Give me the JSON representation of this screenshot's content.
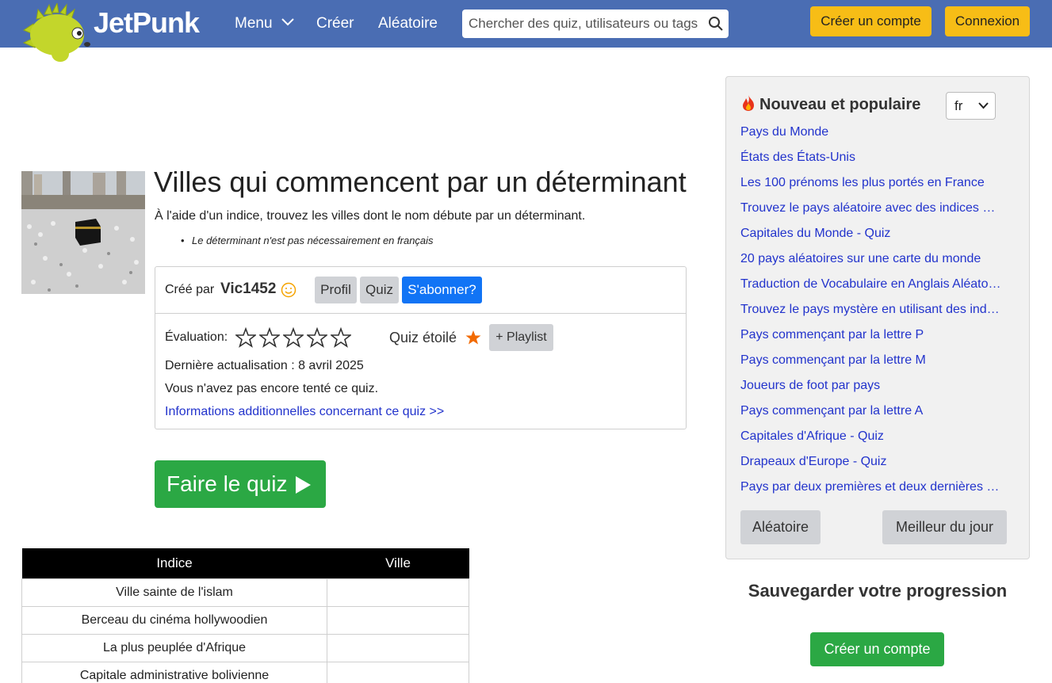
{
  "header": {
    "logo_text": "JetPunk",
    "nav": {
      "menu": "Menu",
      "create": "Créer",
      "random": "Aléatoire"
    },
    "search_placeholder": "Chercher des quiz, utilisateurs ou tags",
    "register": "Créer un compte",
    "login": "Connexion",
    "brand_color": "#4a6db3",
    "accent_color": "#f7bd16"
  },
  "quiz": {
    "title": "Villes qui commencent par un déterminant",
    "description": "À l'aide d'un indice, trouvez les villes dont le nom débute par un déterminant.",
    "note": "Le déterminant n'est pas nécessairement en français",
    "created_by_label": "Créé par",
    "author": "Vic1452",
    "profile_button": "Profil",
    "quiz_button": "Quiz",
    "subscribe_button": "S'abonner?",
    "rating_label": "Évaluation:",
    "rating_stars_filled": 0,
    "rating_stars_total": 5,
    "starred_label": "Quiz étoilé",
    "playlist_button": "+ Playlist",
    "updated": "Dernière actualisation : 8 avril 2025",
    "not_tried": "Vous n'avez pas encore tenté ce quiz.",
    "more_info": "Informations additionnelles concernant ce quiz >>",
    "take_quiz": "Faire le quiz"
  },
  "table": {
    "headers": [
      "Indice",
      "Ville"
    ],
    "rows": [
      {
        "clue": "Ville sainte de l'islam",
        "answer": ""
      },
      {
        "clue": "Berceau du cinéma hollywoodien",
        "answer": ""
      },
      {
        "clue": "La plus peuplée d'Afrique",
        "answer": ""
      },
      {
        "clue": "Capitale administrative bolivienne",
        "answer": ""
      }
    ]
  },
  "sidebar": {
    "title": "Nouveau et populaire",
    "language": "fr",
    "items": [
      "Pays du Monde",
      "États des États-Unis",
      "Les 100 prénoms les plus portés en France",
      "Trouvez le pays aléatoire avec des indices …",
      "Capitales du Monde - Quiz",
      "20 pays aléatoires sur une carte du monde",
      "Traduction de Vocabulaire en Anglais Aléato…",
      "Trouvez le pays mystère en utilisant des ind…",
      "Pays commençant par la lettre P",
      "Pays commençant par la lettre M",
      "Joueurs de foot par pays",
      "Pays commençant par la lettre A",
      "Capitales d'Afrique - Quiz",
      "Drapeaux d'Europe - Quiz",
      "Pays par deux premières et deux dernières …"
    ],
    "random_button": "Aléatoire",
    "best_button": "Meilleur du jour"
  },
  "save_progress": {
    "title": "Sauvegarder votre progression",
    "button": "Créer un compte"
  }
}
